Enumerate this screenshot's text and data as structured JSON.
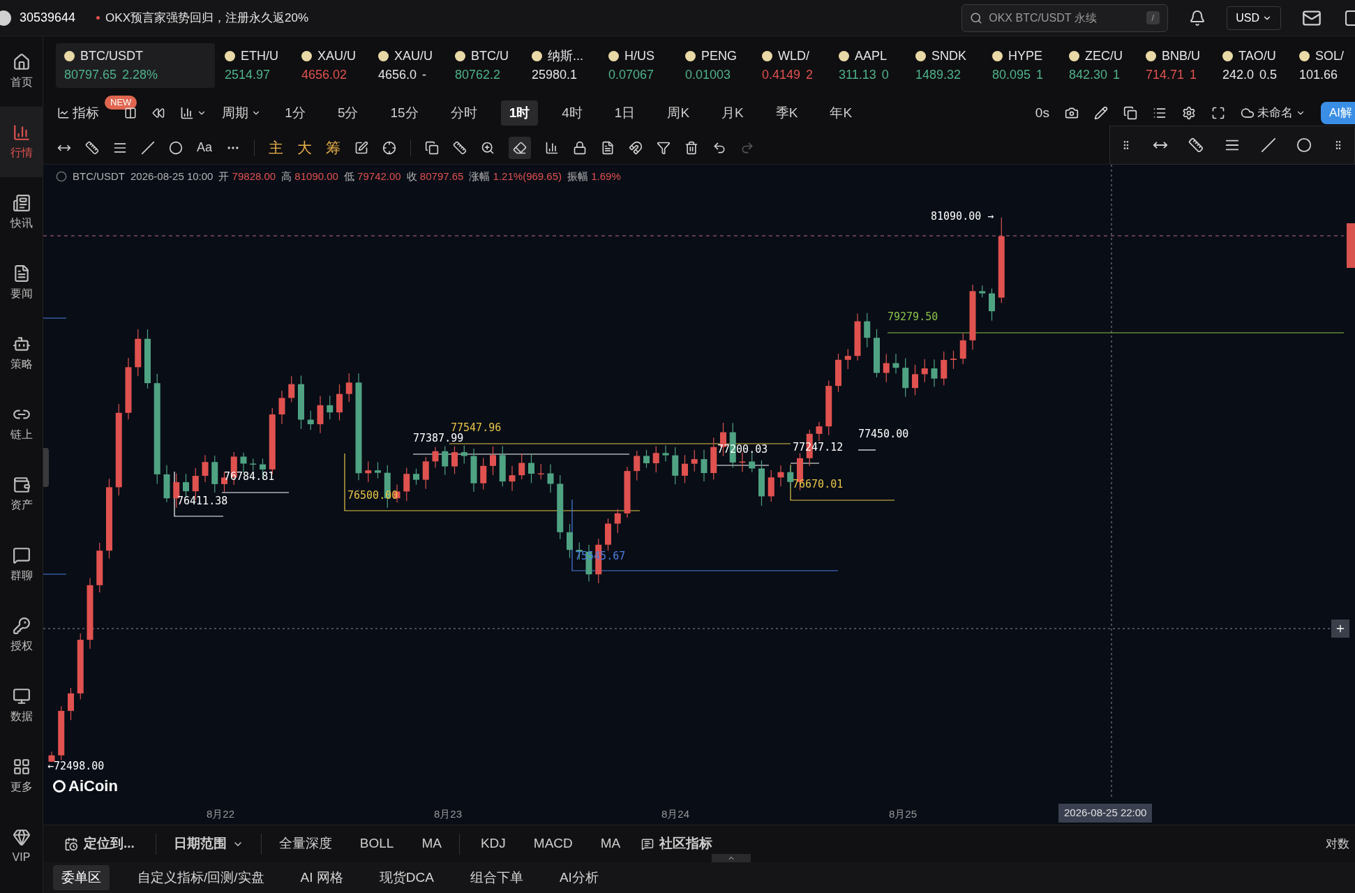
{
  "top_bar": {
    "account": "30539644",
    "promo": "OKX预言家强势回归，注册永久返20%",
    "search": {
      "placeholder": "OKX BTC/USDT 永续"
    },
    "search_shortcut": "/",
    "currency": "USD"
  },
  "sidebar": [
    {
      "label": "首页",
      "selected": false
    },
    {
      "label": "行情",
      "selected": true
    },
    {
      "label": "快讯",
      "selected": false
    },
    {
      "label": "要闻",
      "selected": false
    },
    {
      "label": "策略",
      "selected": false
    },
    {
      "label": "链上",
      "selected": false
    },
    {
      "label": "资产",
      "selected": false
    },
    {
      "label": "群聊",
      "selected": false
    },
    {
      "label": "授权",
      "selected": false
    },
    {
      "label": "数据",
      "selected": false
    },
    {
      "label": "更多",
      "selected": false
    },
    {
      "label": "VIP",
      "selected": false
    }
  ],
  "tickers": [
    {
      "symbol": "BTC/USDT",
      "price": "80797.65",
      "change": "2.28%",
      "color": "#4fb38a",
      "selected": true
    },
    {
      "symbol": "ETH/U",
      "price": "2514.97",
      "color": "#4fb38a",
      "selected": false
    },
    {
      "symbol": "XAU/U",
      "price": "4656.02",
      "color": "#e0524f",
      "selected": false
    },
    {
      "symbol": "XAU/U",
      "price": "4656.0",
      "change": "-",
      "color": "#e6e6e6",
      "selected": false
    },
    {
      "symbol": "BTC/U",
      "price": "80762.2",
      "color": "#4fb38a",
      "selected": false
    },
    {
      "symbol": "纳斯...",
      "price": "25980.1",
      "color": "#e6e6e6",
      "selected": false
    },
    {
      "symbol": "H/US",
      "price": "0.07067",
      "color": "#4fb38a",
      "selected": false
    },
    {
      "symbol": "PENG",
      "price": "0.01003",
      "color": "#4fb38a",
      "selected": false
    },
    {
      "symbol": "WLD/",
      "price": "0.4149",
      "change": "2",
      "color": "#e0524f",
      "selected": false
    },
    {
      "symbol": "AAPL",
      "price": "311.13",
      "change": "0",
      "color": "#4fb38a",
      "selected": false
    },
    {
      "symbol": "SNDK",
      "price": "1489.32",
      "color": "#4fb38a",
      "selected": false
    },
    {
      "symbol": "HYPE",
      "price": "80.095",
      "change": "1",
      "color": "#4fb38a",
      "selected": false
    },
    {
      "symbol": "ZEC/U",
      "price": "842.30",
      "change": "1",
      "color": "#4fb38a",
      "selected": false
    },
    {
      "symbol": "BNB/U",
      "price": "714.71",
      "change": "1",
      "color": "#e0524f",
      "selected": false
    },
    {
      "symbol": "TAO/U",
      "price": "242.0",
      "change": "0.5",
      "color": "#e6e6e6",
      "selected": false
    },
    {
      "symbol": "SOL/",
      "price": "101.66",
      "color": "#e6e6e6",
      "selected": false
    }
  ],
  "toolbar": {
    "indicator": "指标",
    "badge": "NEW",
    "period": "周期",
    "intervals": [
      {
        "label": "1分",
        "selected": false
      },
      {
        "label": "5分",
        "selected": false
      },
      {
        "label": "15分",
        "selected": false
      },
      {
        "label": "分时",
        "selected": false
      },
      {
        "label": "1时",
        "selected": true
      },
      {
        "label": "4时",
        "selected": false
      },
      {
        "label": "1日",
        "selected": false
      },
      {
        "label": "周K",
        "selected": false
      },
      {
        "label": "月K",
        "selected": false
      },
      {
        "label": "季K",
        "selected": false
      },
      {
        "label": "年K",
        "selected": false
      }
    ],
    "countdown": "0s",
    "layout_name": "未命名",
    "ai_button": "AI解"
  },
  "drawing_tools": {
    "text_tool": "Aa",
    "modes": [
      "主",
      "大",
      "筹"
    ]
  },
  "info": {
    "symbol": "BTC/USDT",
    "time": "2026-08-25 10:00",
    "fields": [
      {
        "label": "开",
        "value": "79828.00"
      },
      {
        "label": "高",
        "value": "81090.00"
      },
      {
        "label": "低",
        "value": "79742.00"
      },
      {
        "label": "收",
        "value": "80797.65"
      },
      {
        "label": "涨幅",
        "value": "1.21%(969.65)"
      },
      {
        "label": "振幅",
        "value": "1.69%"
      }
    ]
  },
  "chart": {
    "annotations": [
      {
        "text": "81090.00 →",
        "color": "#ffffff"
      },
      {
        "text": "79279.50",
        "color": "#8bc34a"
      },
      {
        "text": "77547.96",
        "color": "#e8c547"
      },
      {
        "text": "77387.99",
        "color": "#ffffff"
      },
      {
        "text": "76784.81",
        "color": "#ffffff"
      },
      {
        "text": "76411.38",
        "color": "#ffffff"
      },
      {
        "text": "76500.00",
        "color": "#e8c547"
      },
      {
        "text": "75545.67",
        "color": "#4a7fe0"
      },
      {
        "text": "77200.03",
        "color": "#ffffff"
      },
      {
        "text": "77247.12",
        "color": "#ffffff"
      },
      {
        "text": "76670.01",
        "color": "#e8c547"
      },
      {
        "text": "77450.00",
        "color": "#ffffff"
      },
      {
        "text": "←72498.00",
        "color": "#ffffff"
      }
    ],
    "x_labels": [
      "8月22",
      "8月23",
      "8月24",
      "8月25"
    ],
    "crosshair_label": "2026-08-25 22:00",
    "logo": "AiCoin"
  },
  "bottom_bar": {
    "locate": "定位到...",
    "date_range": "日期范围",
    "indicators": [
      "全量深度",
      "BOLL",
      "MA"
    ],
    "indicators_2": [
      "KDJ",
      "MACD",
      "MA"
    ],
    "community": "社区指标",
    "log_scale": "对数"
  },
  "panel_tabs": [
    {
      "label": "委单区",
      "selected": true
    },
    {
      "label": "自定义指标/回测/实盘",
      "selected": false
    },
    {
      "label": "AI 网格",
      "selected": false
    },
    {
      "label": "现货DCA",
      "selected": false
    },
    {
      "label": "组合下单",
      "selected": false
    },
    {
      "label": "AI分析",
      "selected": false
    }
  ]
}
